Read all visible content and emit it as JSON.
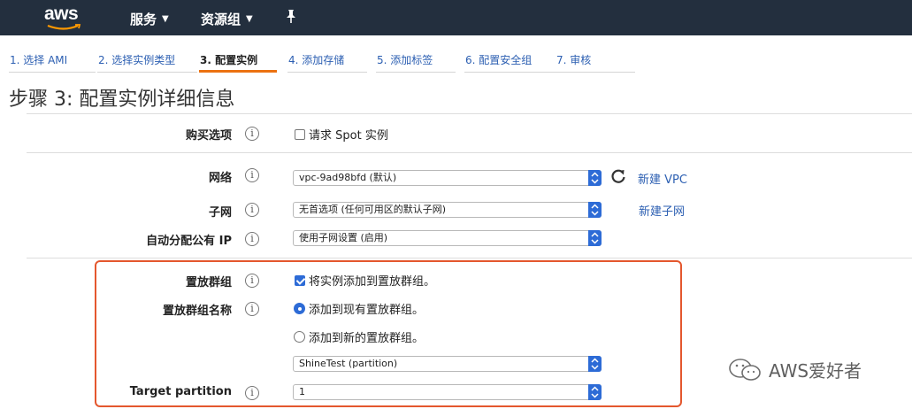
{
  "nav": {
    "logo": "aws",
    "services": "服务",
    "resource_groups": "资源组"
  },
  "tabs": [
    {
      "label": "1. 选择 AMI"
    },
    {
      "label": "2. 选择实例类型"
    },
    {
      "label": "3. 配置实例"
    },
    {
      "label": "4. 添加存储"
    },
    {
      "label": "5. 添加标签"
    },
    {
      "label": "6. 配置安全组"
    },
    {
      "label": "7. 审核"
    }
  ],
  "page_title": "步骤 3: 配置实例详细信息",
  "form": {
    "purchase_option": {
      "label": "购买选项",
      "checkbox_label": "请求 Spot 实例",
      "checked": false
    },
    "network": {
      "label": "网络",
      "value": "vpc-9ad98bfd (默认)",
      "link": "新建 VPC"
    },
    "subnet": {
      "label": "子网",
      "value": "无首选项 (任何可用区的默认子网)",
      "link": "新建子网"
    },
    "public_ip": {
      "label": "自动分配公有 IP",
      "value": "使用子网设置 (启用)"
    },
    "placement_group": {
      "label": "置放群组",
      "checkbox_label": "将实例添加到置放群组。",
      "checked": true
    },
    "placement_group_name": {
      "label": "置放群组名称",
      "option_existing": "添加到现有置放群组。",
      "option_new": "添加到新的置放群组。",
      "selected": "existing",
      "value": "ShineTest (partition)"
    },
    "target_partition": {
      "label": "Target partition",
      "value": "1"
    }
  },
  "info_glyph": "i",
  "watermark": "AWS爱好者",
  "colors": {
    "nav_bg": "#232f3e",
    "link": "#2c5fb2",
    "active_tab": "#ec7211",
    "highlight": "#e4572e",
    "select_arrow": "#2d6bd6"
  }
}
